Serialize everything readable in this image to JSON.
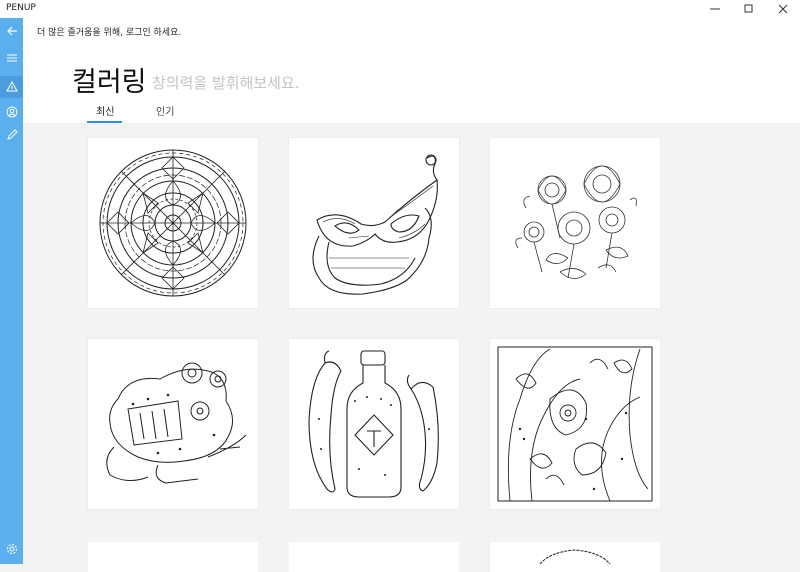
{
  "window": {
    "title": "PENUP"
  },
  "header": {
    "login_prompt": "더 많은 즐거움을 위해, 로그인 하세요.",
    "title": "컬러링",
    "subtitle": "창의력을 발휘해보세요."
  },
  "tabs": [
    {
      "label": "최신",
      "selected": true
    },
    {
      "label": "인기",
      "selected": false
    }
  ],
  "sidebar": {
    "items": [
      {
        "icon": "back-arrow-icon"
      },
      {
        "icon": "hamburger-menu-icon"
      },
      {
        "icon": "triangle-icon"
      },
      {
        "icon": "profile-icon"
      },
      {
        "icon": "pencil-icon"
      },
      {
        "icon": "settings-icon"
      }
    ]
  },
  "cards": [
    {
      "subject": "mandala"
    },
    {
      "subject": "masquerade-mask"
    },
    {
      "subject": "flowers"
    },
    {
      "subject": "steampunk-frog"
    },
    {
      "subject": "hot-sauce-bottle-with-peppers"
    },
    {
      "subject": "paisley-pattern"
    }
  ],
  "colors": {
    "sidebar": "#5aafee",
    "accent": "#2d8ce6"
  }
}
